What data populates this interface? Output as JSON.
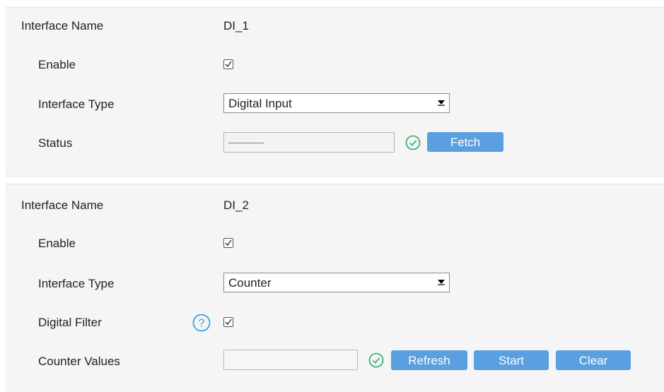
{
  "di1": {
    "interface_name_label": "Interface Name",
    "interface_name_value": "DI_1",
    "enable_label": "Enable",
    "enable_checked": true,
    "interface_type_label": "Interface Type",
    "interface_type_value": "Digital Input",
    "status_label": "Status",
    "status_value": "————",
    "fetch_button": "Fetch"
  },
  "di2": {
    "interface_name_label": "Interface Name",
    "interface_name_value": "DI_2",
    "enable_label": "Enable",
    "enable_checked": true,
    "interface_type_label": "Interface Type",
    "interface_type_value": "Counter",
    "digital_filter_label": "Digital Filter",
    "digital_filter_checked": true,
    "counter_values_label": "Counter Values",
    "counter_values_value": "",
    "refresh_button": "Refresh",
    "start_button": "Start",
    "clear_button": "Clear"
  },
  "colors": {
    "button_bg": "#5a9fe0",
    "ok_icon": "#3cb371",
    "help_icon": "#2ea8d8"
  },
  "icons": {
    "ok": "check-circle-icon",
    "help": "question-circle-icon",
    "dropdown": "caret-down-icon",
    "checkmark": "checkmark-icon"
  }
}
